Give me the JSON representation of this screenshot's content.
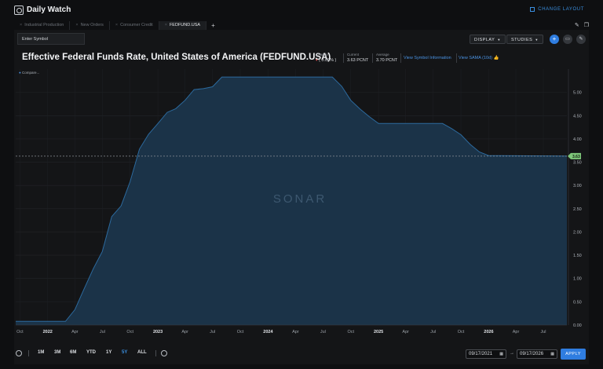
{
  "app": {
    "title": "Daily Watch",
    "change_layout": "CHANGE LAYOUT"
  },
  "tabs": [
    {
      "label": "Industrial Production",
      "active": false
    },
    {
      "label": "New Orders",
      "active": false
    },
    {
      "label": "Consumer Credit",
      "active": false
    },
    {
      "label": "FEDFUND.USA",
      "active": true
    }
  ],
  "tab_add": "+",
  "toolbar": {
    "symbol_placeholder": "Enter Symbol",
    "display": "DISPLAY",
    "studies": "STUDIES"
  },
  "chart_header": {
    "title": "Effective Federal Funds Rate, United States of America (FEDFUND.USA)",
    "change_label": "Change",
    "change_value": "( 0.00% )",
    "current_label": "Current",
    "current_value": "3.63 PCNT",
    "average_label": "Average",
    "average_value": "3.70 PCNT",
    "link_symbol_info": "View Symbol Information",
    "link_sama": "View SAMA (10d)"
  },
  "legend_mini": "Compare...",
  "watermark": "SONAR",
  "colors": {
    "accent": "#2f7de0",
    "area_fill": "#1b3348",
    "line": "#2c6a9e",
    "current_badge": "#7ec77a"
  },
  "chart_data": {
    "type": "area",
    "title": "Effective Federal Funds Rate, United States of America (FEDFUND.USA)",
    "xlabel": "",
    "ylabel": "",
    "ylim": [
      0,
      5.5
    ],
    "yticks": [
      "0.00",
      "0.50",
      "1.00",
      "1.50",
      "2.00",
      "2.50",
      "3.00",
      "3.50",
      "4.00",
      "4.50",
      "5.00"
    ],
    "current_value_label": "3.63",
    "x_labels": [
      "Oct",
      "2022",
      "Apr",
      "Jul",
      "Oct",
      "2023",
      "Apr",
      "Jul",
      "Oct",
      "2024",
      "Apr",
      "Jul",
      "Oct",
      "2025",
      "Apr",
      "Jul",
      "Oct",
      "2026",
      "Apr",
      "Jul"
    ],
    "x": [
      "2021-09-17",
      "2022-01-01",
      "2022-03-01",
      "2022-04-01",
      "2022-05-01",
      "2022-06-01",
      "2022-07-01",
      "2022-08-01",
      "2022-09-01",
      "2022-10-01",
      "2022-11-01",
      "2022-12-01",
      "2023-01-01",
      "2023-02-01",
      "2023-03-01",
      "2023-04-01",
      "2023-05-01",
      "2023-06-01",
      "2023-07-01",
      "2023-08-01",
      "2024-08-01",
      "2024-09-01",
      "2024-10-01",
      "2024-11-01",
      "2024-12-01",
      "2025-01-01",
      "2025-08-01",
      "2025-09-01",
      "2025-10-01",
      "2025-11-01",
      "2025-12-01",
      "2026-01-01",
      "2026-09-17"
    ],
    "values": [
      0.08,
      0.08,
      0.08,
      0.33,
      0.77,
      1.21,
      1.58,
      2.33,
      2.56,
      3.08,
      3.78,
      4.1,
      4.33,
      4.57,
      4.65,
      4.83,
      5.06,
      5.08,
      5.12,
      5.33,
      5.33,
      5.13,
      4.83,
      4.64,
      4.48,
      4.33,
      4.33,
      4.22,
      4.09,
      3.88,
      3.72,
      3.64,
      3.63
    ],
    "current": 3.63,
    "grid": true,
    "legend": "top-left"
  },
  "bottom": {
    "ranges": [
      {
        "label": "1M",
        "active": false
      },
      {
        "label": "3M",
        "active": false
      },
      {
        "label": "6M",
        "active": false
      },
      {
        "label": "YTD",
        "active": false
      },
      {
        "label": "1Y",
        "active": false
      },
      {
        "label": "5Y",
        "active": true
      },
      {
        "label": "ALL",
        "active": false
      }
    ],
    "date_from": "09/17/2021",
    "date_to": "09/17/2026",
    "arrow": "→",
    "apply": "APPLY"
  }
}
